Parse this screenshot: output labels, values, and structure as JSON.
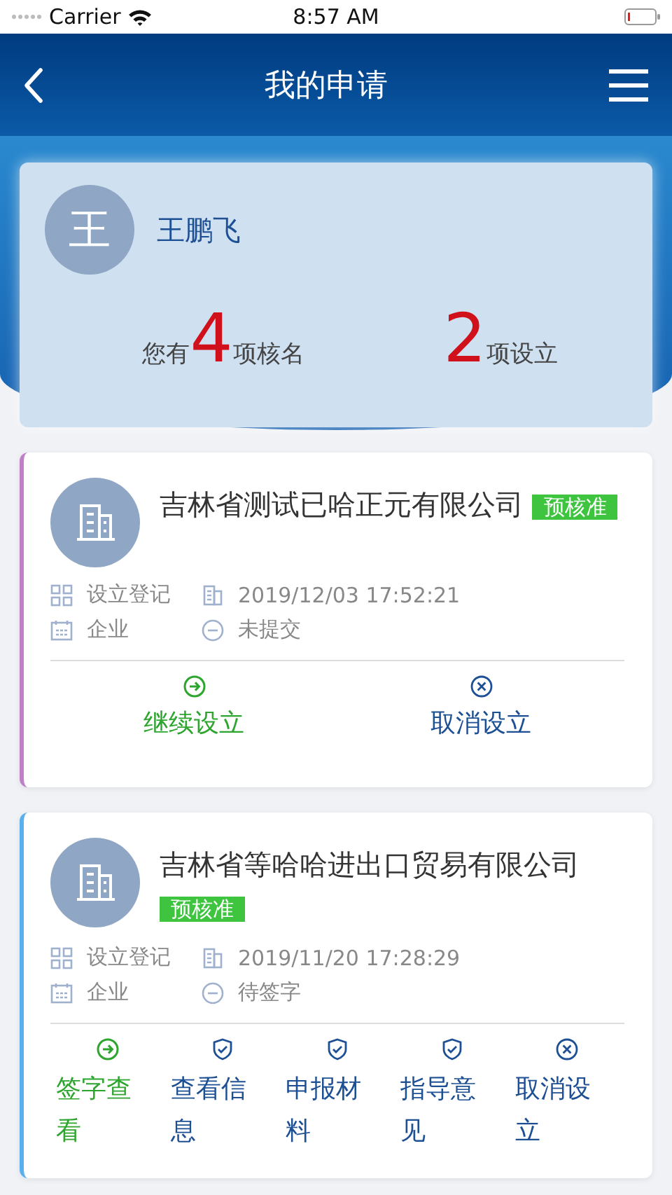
{
  "status_bar": {
    "carrier": "Carrier",
    "time": "8:57 AM"
  },
  "nav": {
    "title": "我的申请"
  },
  "summary": {
    "avatar": "王",
    "name": "王鹏飞",
    "stats": [
      {
        "prefix": "您有",
        "count": "4",
        "unit": "项核名"
      },
      {
        "count": "2",
        "unit": "项设立"
      }
    ]
  },
  "applications": [
    {
      "color": "#c080c8",
      "name": "吉林省测试已哈正元有限公司",
      "badge": "预核准",
      "type": "设立登记",
      "date": "2019/12/03 17:52:21",
      "entity": "企业",
      "status": "未提交",
      "actions": [
        {
          "kind": "go",
          "label": "继续设立"
        },
        {
          "kind": "cancel",
          "label": "取消设立"
        }
      ]
    },
    {
      "color": "#5ab0ee",
      "name": "吉林省等哈哈进出口贸易有限公司",
      "badge": "预核准",
      "type": "设立登记",
      "date": "2019/11/20 17:28:29",
      "entity": "企业",
      "status": "待签字",
      "actions": [
        {
          "kind": "go",
          "label": "签字查看"
        },
        {
          "kind": "shield",
          "label": "查看信息"
        },
        {
          "kind": "shield",
          "label": "申报材料"
        },
        {
          "kind": "shield",
          "label": "指导意见"
        },
        {
          "kind": "cancel",
          "label": "取消设立"
        }
      ]
    }
  ]
}
